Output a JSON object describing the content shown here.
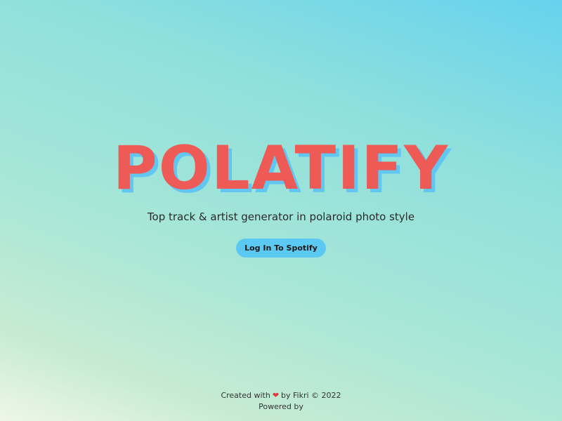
{
  "hero": {
    "logo": "POLATIFY",
    "tagline": "Top track & artist generator in polaroid photo style",
    "login_label": "Log In To Spotify"
  },
  "footer": {
    "created_prefix": "Created with",
    "heart_icon": "heart-icon",
    "created_suffix": "by Fikri © 2022",
    "powered_by": "Powered by"
  },
  "colors": {
    "logo": "#ee5a55",
    "logo_shadow": "#62c6f0",
    "button": "#5cc9f2",
    "heart": "#e63434"
  }
}
